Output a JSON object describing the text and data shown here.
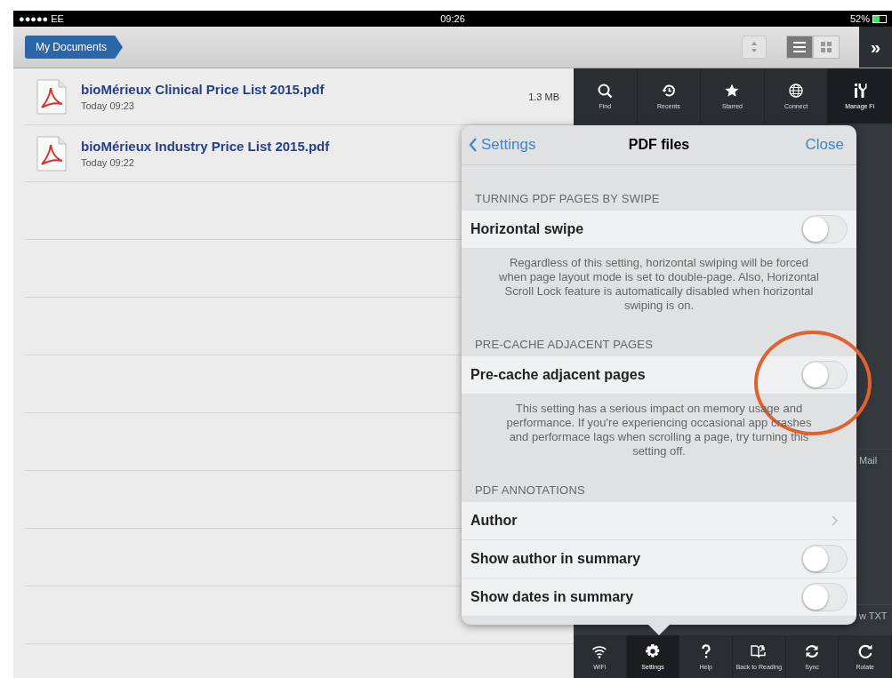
{
  "status_bar": {
    "carrier": "●●●●● EE",
    "time": "09:26",
    "battery": "52%"
  },
  "nav": {
    "breadcrumb": "My Documents",
    "view_modes": [
      {
        "kind": "list",
        "selected": true
      },
      {
        "kind": "grid",
        "selected": false
      }
    ],
    "more": "»"
  },
  "files": [
    {
      "name": "bioMérieux Clinical Price List 2015.pdf",
      "date": "Today 09:23",
      "size": "1.3 MB"
    },
    {
      "name": "bioMérieux Industry Price List 2015.pdf",
      "date": "Today 09:22"
    }
  ],
  "top_tools": [
    {
      "kind": "search",
      "label": "Find",
      "selected": false
    },
    {
      "kind": "recent",
      "label": "Recents",
      "selected": false
    },
    {
      "kind": "star",
      "label": "Starred",
      "selected": false
    },
    {
      "kind": "globe",
      "label": "Connect",
      "selected": false
    },
    {
      "kind": "tools",
      "label": "Manage Fi",
      "selected": true
    }
  ],
  "side_labels": [
    "Mail",
    "w TXT"
  ],
  "popover": {
    "back": "Settings",
    "title": "PDF files",
    "close": "Close",
    "sections": [
      {
        "header": "TURNING PDF PAGES BY SWIPE",
        "rows": [
          {
            "kind": "toggle",
            "label": "Horizontal swipe",
            "on": false
          }
        ],
        "footer": "Regardless of this setting, horizontal swiping will be forced when page layout mode is set to double-page. Also, Horizontal Scroll Lock feature is automatically disabled when horizontal swiping is on."
      },
      {
        "header": "PRE-CACHE ADJACENT PAGES",
        "rows": [
          {
            "kind": "toggle",
            "label": "Pre-cache adjacent pages",
            "on": false
          }
        ],
        "footer": "This setting has a serious impact on memory usage and performance. If you're experiencing occasional app crashes and performace lags when scrolling a page, try turning this setting off."
      },
      {
        "header": "PDF ANNOTATIONS",
        "rows": [
          {
            "kind": "link",
            "label": "Author"
          },
          {
            "kind": "toggle",
            "label": "Show author in summary",
            "on": false
          },
          {
            "kind": "toggle",
            "label": "Show dates in summary",
            "on": false
          }
        ]
      }
    ]
  },
  "bottom_tools": [
    {
      "kind": "wifi",
      "label": "WiFi",
      "selected": false
    },
    {
      "kind": "gear",
      "label": "Settings",
      "selected": true
    },
    {
      "kind": "help",
      "label": "Help",
      "selected": false
    },
    {
      "kind": "book",
      "label": "Back to Reading",
      "selected": false
    },
    {
      "kind": "sync",
      "label": "Sync",
      "selected": false
    },
    {
      "kind": "rotate",
      "label": "Rotate",
      "selected": false
    }
  ]
}
